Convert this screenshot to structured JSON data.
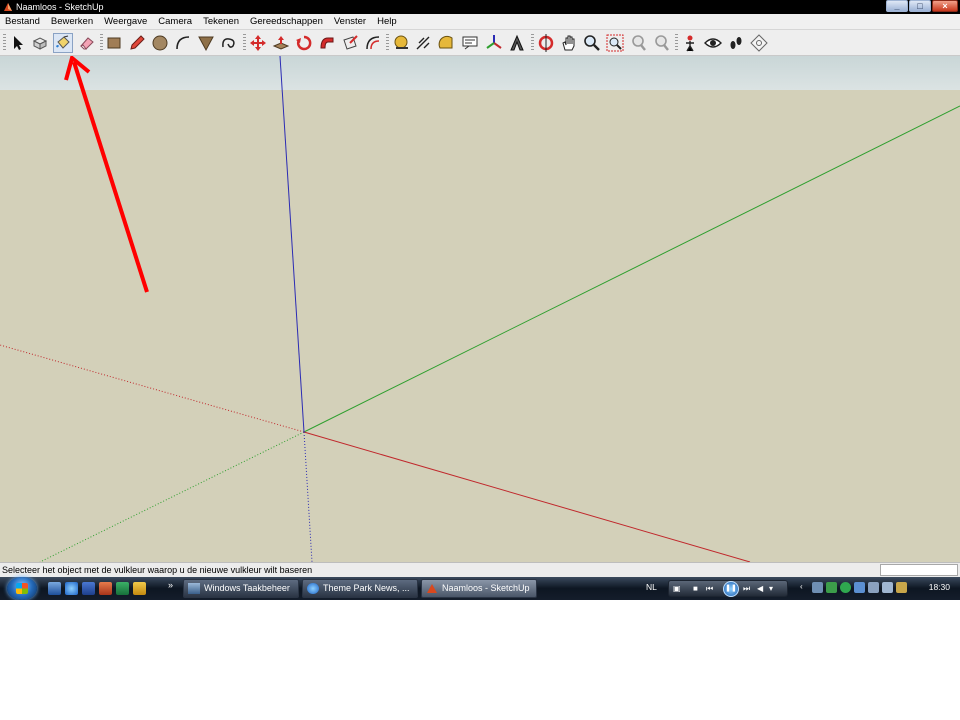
{
  "window": {
    "title": "Naamloos - SketchUp"
  },
  "menu": [
    "Bestand",
    "Bewerken",
    "Weergave",
    "Camera",
    "Tekenen",
    "Gereedschappen",
    "Venster",
    "Help"
  ],
  "status": {
    "hint": "Selecteer het object met de vulkleur waarop u de nieuwe vulkleur wilt baseren"
  },
  "taskbar": {
    "tasks": [
      "Windows Taakbeheer",
      "Theme Park News, ...",
      "Naamloos - SketchUp"
    ],
    "language": "NL",
    "clock": "18:30",
    "overflow": "»"
  },
  "colors": {
    "axis_red": "#c0282c",
    "axis_green": "#2f9f2f",
    "axis_blue": "#2b2bb4",
    "annotation_arrow": "#ff0000",
    "ground": "#d3d0b9"
  },
  "toolbar_icons": [
    "select-arrow-icon",
    "make-component-icon",
    "paint-bucket-icon",
    "eraser-icon",
    "rectangle-icon",
    "pencil-icon",
    "circle-icon",
    "arc-icon",
    "polygon-icon",
    "freehand-icon",
    "move-icon",
    "push-pull-icon",
    "rotate-icon",
    "follow-me-icon",
    "scale-icon",
    "offset-icon",
    "tape-measure-icon",
    "dimension-icon",
    "protractor-icon",
    "text-icon",
    "axes-icon",
    "3d-text-icon",
    "orbit-icon",
    "pan-icon",
    "zoom-icon",
    "zoom-window-icon",
    "previous-view-icon",
    "next-view-icon",
    "position-camera-icon",
    "look-around-icon",
    "walk-icon",
    "section-plane-icon"
  ]
}
